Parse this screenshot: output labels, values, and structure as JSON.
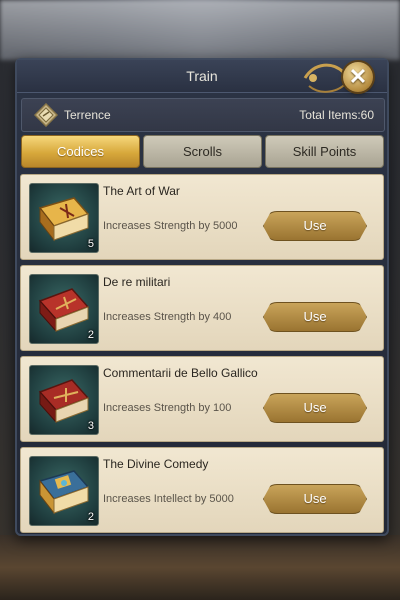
{
  "window": {
    "title": "Train",
    "close_icon": "close-x-icon"
  },
  "header": {
    "user_name": "Terrence",
    "user_icon": "diamond-badge-icon",
    "total_items": "Total Items:60"
  },
  "tabs": [
    {
      "label": "Codices",
      "active": true
    },
    {
      "label": "Scrolls",
      "active": false
    },
    {
      "label": "Skill Points",
      "active": false
    }
  ],
  "items": [
    {
      "name": "The Art of War",
      "desc": "Increases Strength by 5000",
      "count": "5",
      "button": "Use",
      "icon": "gold-book-icon",
      "cover": "#c98a2a"
    },
    {
      "name": "De re militari",
      "desc": "Increases Strength by 400",
      "count": "2",
      "button": "Use",
      "icon": "red-book-icon",
      "cover": "#9c2a22"
    },
    {
      "name": "Commentarii de Bello Gallico",
      "desc": "Increases Strength by 100",
      "count": "3",
      "button": "Use",
      "icon": "red-book-icon",
      "cover": "#8e2620"
    },
    {
      "name": "The Divine Comedy",
      "desc": "Increases Intellect by 5000",
      "count": "2",
      "button": "Use",
      "icon": "blue-gold-book-icon",
      "cover": "#2f5f8a"
    }
  ],
  "colors": {
    "accent_gold": "#d7a83b",
    "panel": "#2c3445",
    "card": "#f1e7d1"
  }
}
